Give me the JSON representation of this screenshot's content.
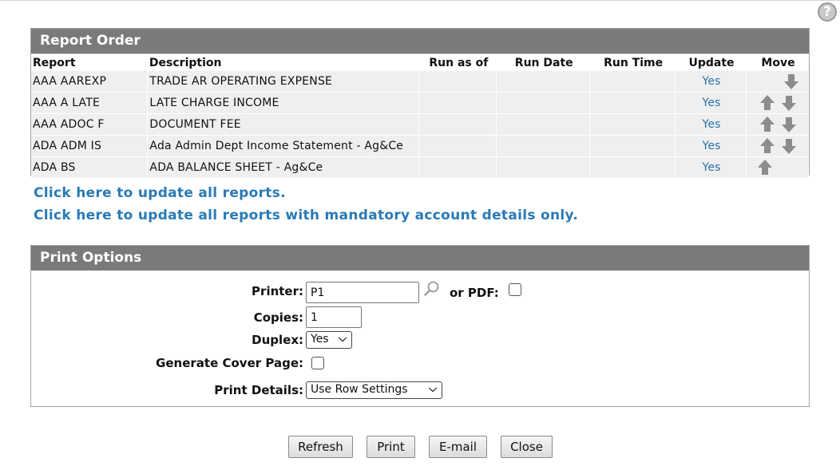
{
  "report_order": {
    "title": "Report Order",
    "columns": {
      "report": "Report",
      "description": "Description",
      "run_as_of": "Run as of",
      "run_date": "Run Date",
      "run_time": "Run Time",
      "update": "Update",
      "move": "Move"
    },
    "rows": [
      {
        "report": "AAA AAREXP",
        "description": "TRADE AR OPERATING EXPENSE",
        "update": "Yes"
      },
      {
        "report": "AAA A LATE",
        "description": "LATE CHARGE INCOME",
        "update": "Yes"
      },
      {
        "report": "AAA ADOC F",
        "description": "DOCUMENT FEE",
        "update": "Yes"
      },
      {
        "report": "ADA ADM IS",
        "description": "Ada Admin Dept Income Statement - Ag&Ce",
        "update": "Yes"
      },
      {
        "report": "ADA BS",
        "description": "ADA BALANCE SHEET - Ag&Ce",
        "update": "Yes"
      }
    ]
  },
  "links": {
    "update_all": "Click here to update all reports.",
    "update_mandatory": "Click here to update all reports with mandatory account details only."
  },
  "print_options": {
    "title": "Print Options",
    "printer_label": "Printer:",
    "printer_value": "P1",
    "pdf_label": "or PDF:",
    "copies_label": "Copies:",
    "copies_value": "1",
    "duplex_label": "Duplex:",
    "duplex_value": "Yes",
    "cover_label": "Generate Cover Page:",
    "details_label": "Print Details:",
    "details_value": "Use Row Settings"
  },
  "buttons": {
    "refresh": "Refresh",
    "print": "Print",
    "email": "E-mail",
    "close": "Close"
  },
  "help_icon": "?",
  "colors": {
    "header_bg": "#7a7a7a",
    "link": "#2a7ab5",
    "update_link": "#2a6fae",
    "row_bg": "#efefef"
  }
}
